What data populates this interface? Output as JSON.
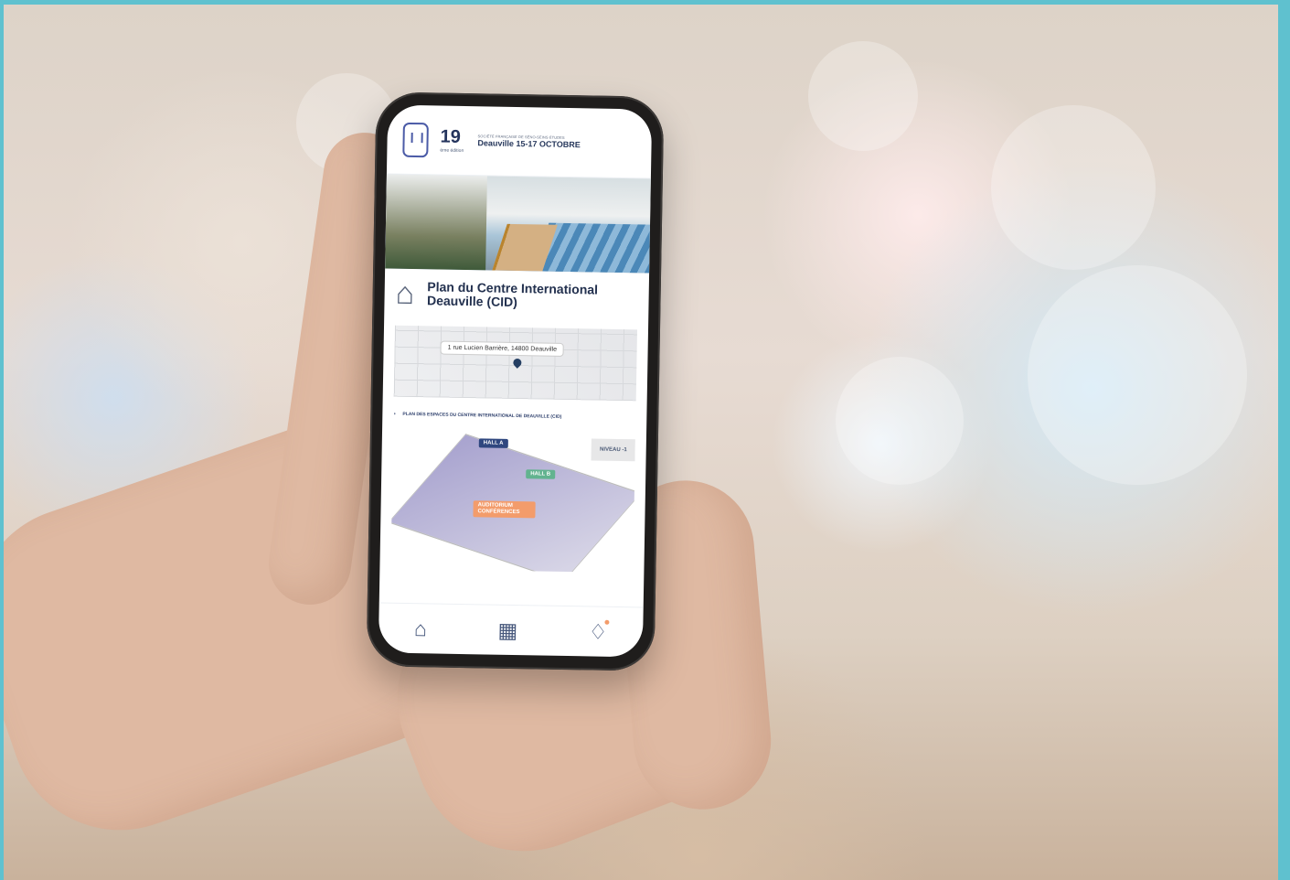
{
  "mockup": {
    "brand_mark": "logo-icon",
    "edition_number": "19",
    "edition_subtitle": "ème édition",
    "society_text": "SOCIÉTÉ FRANÇAISE DE SÉNO-SEINS ÉTUDES",
    "event_dates": "Deauville 15-17 OCTOBRE",
    "plan_title": "Plan du Centre International Deauville (CID)",
    "address": "1 rue Lucien Barrière, 14800 Deauville",
    "spaces_title": "PLAN DES ESPACES DU CENTRE INTERNATIONAL DE DEAUVILLE (CID)",
    "level_label": "NIVEAU -1",
    "hall_a": "HALL A",
    "hall_b": "HALL B",
    "auditorium": "AUDITORIUM CONFÉRENCES",
    "nav_home": "home-icon",
    "nav_calendar": "calendar-icon",
    "nav_notifications": "notification-icon"
  },
  "colors": {
    "border": "#5fc1cf",
    "navy": "#23314f",
    "accent_orange": "#f39c6b",
    "accent_green": "#62b38f"
  }
}
